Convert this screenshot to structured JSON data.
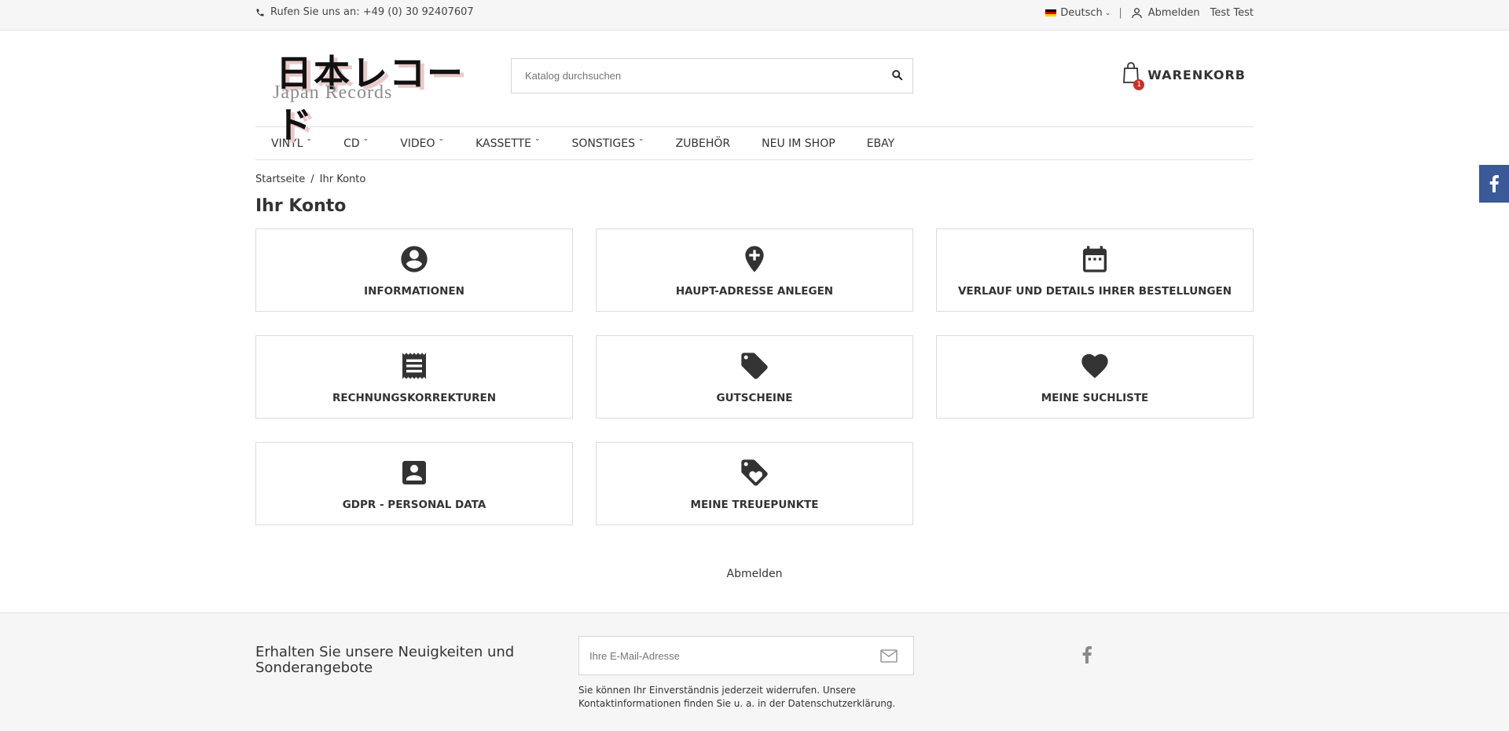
{
  "topbar": {
    "phone_text": "Rufen Sie uns an: +49 (0) 30 92407607",
    "language": "Deutsch",
    "separator": "|",
    "signout": "Abmelden",
    "user": "Test Test"
  },
  "header": {
    "logo_jp": "日本レコード",
    "logo_en": "Japan Records",
    "search_placeholder": "Katalog durchsuchen",
    "cart_label": "WARENKORB",
    "cart_count": "1"
  },
  "nav": {
    "items": [
      {
        "label": "VINYL",
        "dropdown": true
      },
      {
        "label": "CD",
        "dropdown": true
      },
      {
        "label": "VIDEO",
        "dropdown": true
      },
      {
        "label": "KASSETTE",
        "dropdown": true
      },
      {
        "label": "SONSTIGES",
        "dropdown": true
      },
      {
        "label": "ZUBEHÖR",
        "dropdown": false
      },
      {
        "label": "NEU IM SHOP",
        "dropdown": false
      },
      {
        "label": "EBAY",
        "dropdown": false
      }
    ]
  },
  "breadcrumb": {
    "home": "Startseite",
    "separator": "/",
    "current": "Ihr Konto"
  },
  "page_title": "Ihr Konto",
  "cards": [
    {
      "label": "INFORMATIONEN",
      "icon": "account-circle-icon"
    },
    {
      "label": "HAUPT-ADRESSE ANLEGEN",
      "icon": "add-location-icon"
    },
    {
      "label": "VERLAUF UND DETAILS IHRER BESTELLUNGEN",
      "icon": "calendar-icon"
    },
    {
      "label": "RECHNUNGSKORREKTUREN",
      "icon": "receipt-icon"
    },
    {
      "label": "GUTSCHEINE",
      "icon": "tag-icon"
    },
    {
      "label": "MEINE SUCHLISTE",
      "icon": "heart-icon"
    },
    {
      "label": "GDPR - PERSONAL DATA",
      "icon": "account-box-icon"
    },
    {
      "label": "MEINE TREUEPUNKTE",
      "icon": "loyalty-icon"
    }
  ],
  "logout_link": "Abmelden",
  "footer": {
    "newsletter_title": "Erhalten Sie unsere Neuigkeiten und Sonderangebote",
    "email_placeholder": "Ihre E-Mail-Adresse",
    "consent_text": "Sie können Ihr Einverständnis jederzeit widerrufen. Unsere Kontaktinformationen finden Sie u. a. in der Datenschutzerklärung."
  },
  "colors": {
    "accent": "#3b5998",
    "badge": "#c9302c",
    "text": "#333333"
  }
}
